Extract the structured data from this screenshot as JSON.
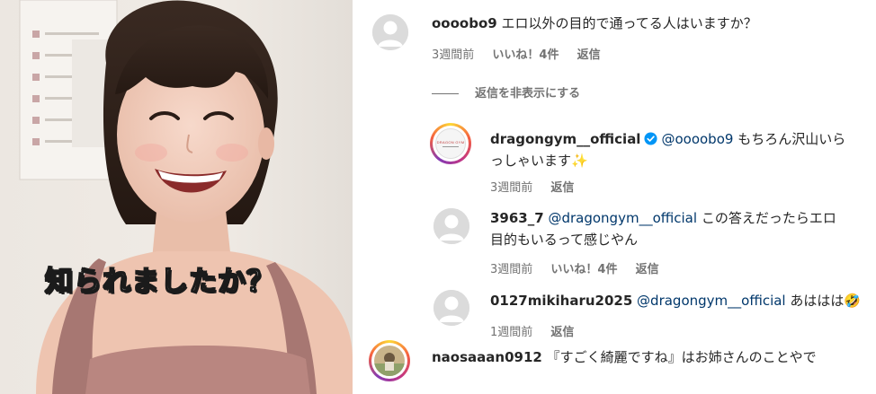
{
  "media": {
    "caption": "知られましたか？"
  },
  "comments": [
    {
      "username": "oooobo9",
      "text": "エロ以外の目的で通ってる人はいますか？",
      "time": "3週間前",
      "likes": "いいね！4件",
      "reply": "返信"
    }
  ],
  "hide_replies_label": "返信を非表示にする",
  "replies": [
    {
      "username": "dragongym__official",
      "mention": "@oooobo9",
      "text_line1": "もちろん沢山いら",
      "text_line2": "っしゃいます",
      "emoji": "✨",
      "time": "3週間前",
      "reply": "返信",
      "logo_text": "DRAGON GYM"
    },
    {
      "username": "3963_7",
      "mention": "@dragongym__official",
      "text_line1": "この答えだったらエロ",
      "text_line2": "目的もいるって感じやん",
      "time": "3週間前",
      "likes": "いいね！4件",
      "reply": "返信"
    },
    {
      "username": "0127mikiharu2025",
      "mention": "@dragongym__official",
      "text_line1": "あははは",
      "emoji": "🤣",
      "time": "1週間前",
      "reply": "返信"
    }
  ],
  "last_comment": {
    "username": "naosaaan0912",
    "text": "『すごく綺麗ですね』はお姉さんのことやで"
  }
}
